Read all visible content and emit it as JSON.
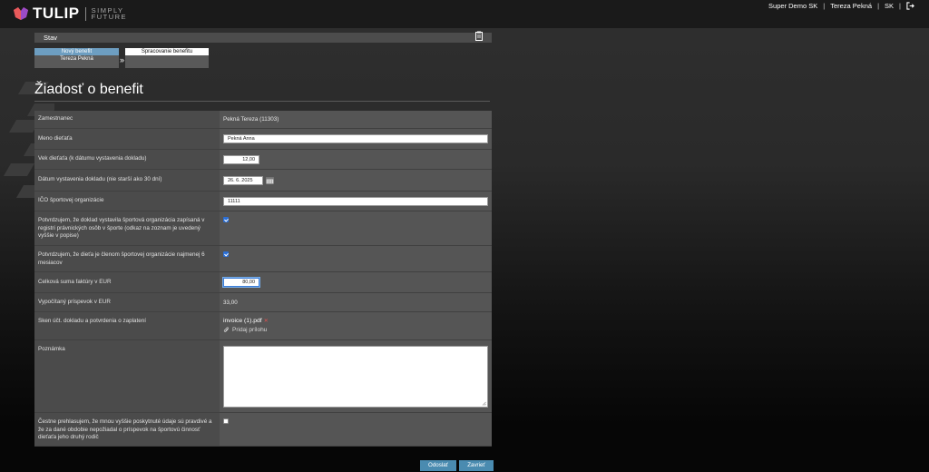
{
  "header": {
    "logo_text": "TULIP",
    "tagline_line1": "SIMPLY",
    "tagline_line2": "FUTURE",
    "nav": [
      {
        "label": "Super Demo SK"
      },
      {
        "label": "Tereza Pekná"
      },
      {
        "label": "SK"
      }
    ],
    "separator": "|",
    "logout_icon": "logout-icon"
  },
  "status_bar": {
    "label": "Stav",
    "icon": "clipboard-icon"
  },
  "workflow": {
    "steps": [
      {
        "title": "Nový benefit",
        "subtitle": "Tereza Pekná",
        "state": "active"
      },
      {
        "title": "Spracovanie benefitu",
        "subtitle": "",
        "state": "pending"
      }
    ],
    "arrow": "»"
  },
  "page_title": "Žiadosť o benefit",
  "form": {
    "employee": {
      "label": "Zamestnanec",
      "value": "Pekná Tereza (11303)"
    },
    "child_name": {
      "label": "Meno dieťaťa",
      "value": "Pekná Anna"
    },
    "child_age": {
      "label": "Vek dieťaťa (k dátumu vystavenia dokladu)",
      "value": "12,00"
    },
    "doc_date": {
      "label": "Dátum vystavenia dokladu (nie starší ako 30 dní)",
      "value": "26. 6. 2025"
    },
    "org_ico": {
      "label": "IČO športovej organizácie",
      "value": "11111"
    },
    "confirm_registry": {
      "label": "Potvrdzujem, že doklad vystavila športová organizácia zapísaná v registri právnických osôb v športe (odkaz na zoznam je uvedený vyššie v popise)",
      "checked": true
    },
    "confirm_membership": {
      "label": "Potvrdzujem, že dieťa je členom športovej organizácie najmenej 6 mesiacov",
      "checked": true
    },
    "invoice_total": {
      "label": "Celková suma faktúry v EUR",
      "value": "80,00"
    },
    "computed_contribution": {
      "label": "Vypočítaný príspevok v EUR",
      "value": "33,00"
    },
    "scan": {
      "label": "Sken účt. dokladu a potvrdenia o zaplatení",
      "file_name": "invoice (1).pdf",
      "remove": "✕",
      "add_attachment": "Pridaj prílohu"
    },
    "note": {
      "label": "Poznámka",
      "value": ""
    },
    "declaration": {
      "label": "Čestne prehlasujem, že mnou vyššie poskytnuté údaje sú pravdivé a že za dané obdobie nepožiadal o príspevok na športovú činnosť dieťaťa jeho druhý rodič",
      "checked": false
    }
  },
  "buttons": {
    "submit": "Odoslať",
    "close": "Zavrieť"
  },
  "colors": {
    "accent": "#4a8bb0",
    "step_active": "#6d9ec1",
    "checkbox": "#2b6fd6",
    "remove_file": "#e05050"
  }
}
